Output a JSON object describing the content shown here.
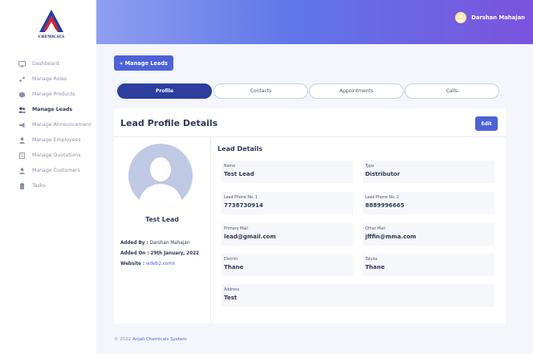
{
  "brand": {
    "logo_text": "CHEMICALS"
  },
  "sidebar": {
    "items": [
      {
        "label": "Dashboard",
        "icon": "monitor-icon"
      },
      {
        "label": "Manage Roles",
        "icon": "roles-icon"
      },
      {
        "label": "Manage Products",
        "icon": "box-icon"
      },
      {
        "label": "Manage Leads",
        "icon": "users-icon"
      },
      {
        "label": "Manage Announcement",
        "icon": "megaphone-icon"
      },
      {
        "label": "Manage Employees",
        "icon": "user-icon"
      },
      {
        "label": "Manage Quotations",
        "icon": "document-icon"
      },
      {
        "label": "Manage Customers",
        "icon": "user-icon"
      },
      {
        "label": "Tasks",
        "icon": "clipboard-icon"
      }
    ],
    "active_index": 3
  },
  "header": {
    "user_name": "Darshan Mahajan"
  },
  "back_button": {
    "label": "« Manage Leads"
  },
  "tabs": [
    {
      "label": "Profile"
    },
    {
      "label": "Contacts"
    },
    {
      "label": "Appointments"
    },
    {
      "label": "Calls"
    }
  ],
  "card": {
    "title": "Lead Profile Details",
    "edit_label": "Edit",
    "lead_name": "Test Lead",
    "added_by_label": "Added By :",
    "added_by_value": "Darshan Mahajan",
    "added_on_label": "Added On :",
    "added_on_value": "29th January, 2022",
    "website_label": "Website :",
    "website_value": "wdeb2.comx",
    "details_title": "Lead Details",
    "fields": [
      {
        "label": "Name",
        "value": "Test Lead"
      },
      {
        "label": "Type",
        "value": "Distributor"
      },
      {
        "label": "Lead Phone No. 1",
        "value": "7738730914"
      },
      {
        "label": "Lead Phone No. 2",
        "value": "8889996665"
      },
      {
        "label": "Primary Mail",
        "value": "lead@gmail.com"
      },
      {
        "label": "Other Mail",
        "value": "jfffin@mma.com"
      },
      {
        "label": "District",
        "value": "Thane"
      },
      {
        "label": "Taluka",
        "value": "Thane"
      },
      {
        "label": "Address",
        "value": "Test"
      }
    ]
  },
  "footer": {
    "copyright": "© 2022",
    "brand": "Anjali Chemicals System"
  },
  "colors": {
    "primary": "#4c62d8",
    "tab_active": "#2c3e9e",
    "header_start": "#8f9ff0",
    "header_end": "#7b53dd"
  }
}
